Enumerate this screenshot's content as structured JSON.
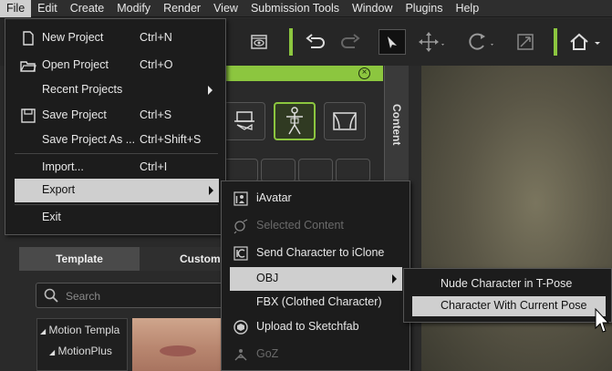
{
  "menubar": {
    "items": [
      "File",
      "Edit",
      "Create",
      "Modify",
      "Render",
      "View",
      "Submission Tools",
      "Window",
      "Plugins",
      "Help"
    ]
  },
  "file_menu": {
    "items": [
      {
        "label": "New Project",
        "shortcut": "Ctrl+N",
        "icon": "new-project-icon"
      },
      {
        "label": "Open Project",
        "shortcut": "Ctrl+O",
        "icon": "folder-icon"
      },
      {
        "label": "Recent Projects",
        "shortcut": "",
        "submenu": true
      },
      {
        "label": "Save Project",
        "shortcut": "Ctrl+S",
        "icon": "save-icon"
      },
      {
        "label": "Save Project As ...",
        "shortcut": "Ctrl+Shift+S"
      },
      {
        "label": "Import...",
        "shortcut": "Ctrl+I"
      },
      {
        "label": "Export",
        "shortcut": "",
        "submenu": true,
        "highlighted": true
      },
      {
        "label": "Exit",
        "shortcut": ""
      }
    ]
  },
  "export_menu": {
    "items": [
      {
        "label": "iAvatar",
        "icon": "iavatar-icon"
      },
      {
        "label": "Selected Content",
        "icon": "selected-content-icon",
        "disabled": true
      },
      {
        "label": "Send Character to iClone",
        "icon": "iclone-icon"
      },
      {
        "label": "OBJ",
        "submenu": true,
        "highlighted": true
      },
      {
        "label": "FBX (Clothed Character)"
      },
      {
        "label": "Upload to Sketchfab",
        "icon": "sketchfab-icon"
      },
      {
        "label": "GoZ",
        "icon": "goz-icon",
        "disabled": true
      }
    ]
  },
  "obj_menu": {
    "items": [
      {
        "label": "Nude Character in T-Pose"
      },
      {
        "label": "Character With Current Pose",
        "highlighted": true
      }
    ]
  },
  "content_panel": {
    "side_tab": "Content",
    "tabs": [
      "Template",
      "Custom"
    ],
    "search_placeholder": "Search",
    "tree": [
      "Motion Templa",
      "MotionPlus"
    ]
  },
  "colors": {
    "accent_green": "#8cc63f",
    "menu_bg": "#1c1c1c",
    "highlight": "#cfcfcf"
  }
}
